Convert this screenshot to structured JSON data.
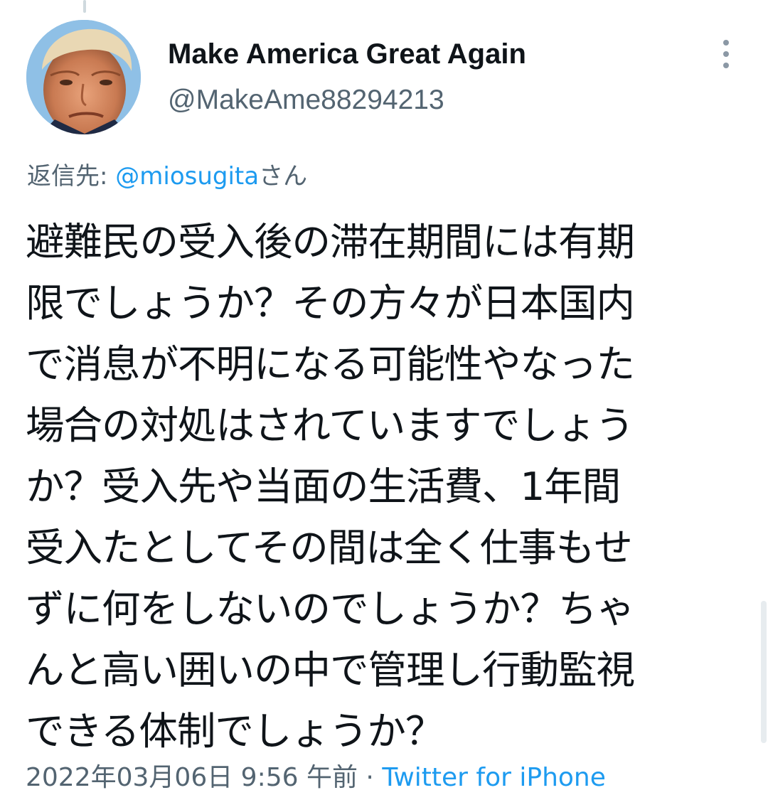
{
  "tweet": {
    "display_name": "Make America Great Again",
    "handle": "@MakeAme88294213",
    "reply_to": {
      "prefix": "返信先: ",
      "mention": "@miosugita",
      "suffix": "さん"
    },
    "text_lines": [
      "避難民の受入後の滞在期間には有期",
      "限でしょうか？その方々が日本国内",
      "で消息が不明になる可能性やなった",
      "場合の対処はされていますでしょう",
      "か？受入先や当面の生活費、1年間",
      "受入たとしてその間は全く仕事もせ",
      "ずに何をしないのでしょうか？ちゃ",
      "んと高い囲いの中で管理し行動監視",
      "できる体制でしょうか？"
    ],
    "timestamp": "2022年03月06日 9:56 午前",
    "separator": " · ",
    "source": "Twitter for iPhone"
  },
  "icons": {
    "avatar": "profile-photo",
    "more": "more-vertical-icon"
  },
  "colors": {
    "text": "#0f1419",
    "secondary": "#536471",
    "link": "#1d9bf0"
  }
}
